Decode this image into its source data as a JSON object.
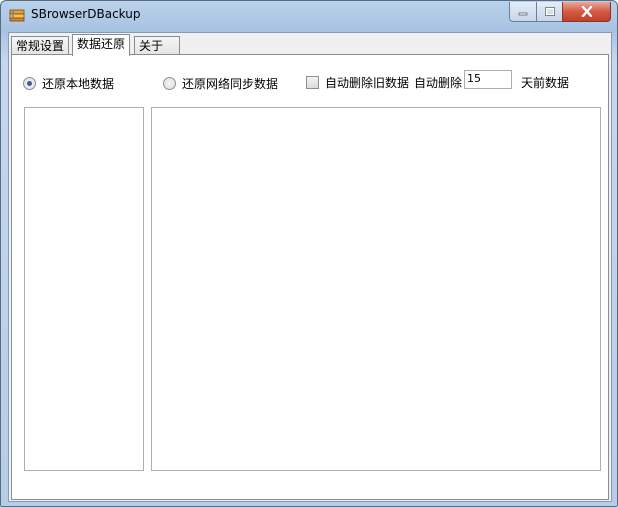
{
  "window": {
    "title": "SBrowserDBackup",
    "controls": {
      "minimize": "minimize",
      "maximize": "maximize",
      "close": "close"
    }
  },
  "tabs": [
    {
      "label": "常规设置",
      "active": false
    },
    {
      "label": "数据还原",
      "active": true
    },
    {
      "label": "关于",
      "active": false
    }
  ],
  "options": {
    "restore_local_label": "还原本地数据",
    "restore_local_checked": true,
    "restore_network_label": "还原网络同步数据",
    "restore_network_checked": false,
    "auto_delete_label": "自动删除旧数据",
    "auto_delete_checked": false,
    "auto_delete_prefix": "自动删除",
    "auto_delete_days": "15",
    "auto_delete_suffix": "天前数据"
  },
  "colors": {
    "accent": "#3e5e9a",
    "close_button": "#c0402b",
    "titlebar": "#b9d1ea"
  }
}
